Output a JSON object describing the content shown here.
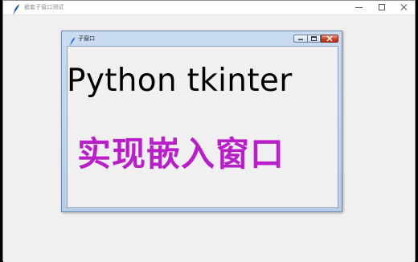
{
  "outer_window": {
    "title": "嵌套子窗口测试",
    "icon": "feather-icon",
    "controls": [
      "minimize-icon",
      "maximize-icon",
      "close-icon"
    ]
  },
  "child_window": {
    "title": "子窗口",
    "icon": "feather-icon",
    "controls": [
      "minimize-icon",
      "maximize-icon",
      "close-icon"
    ],
    "heading": "Python tkinter",
    "caption": "实现嵌入窗口"
  },
  "colors": {
    "caption_text": "#b91fc8",
    "heading_text": "#000000",
    "window_background": "#f0f0f0",
    "child_frame": "#c9dcf1",
    "child_close_button": "#c8432c"
  }
}
